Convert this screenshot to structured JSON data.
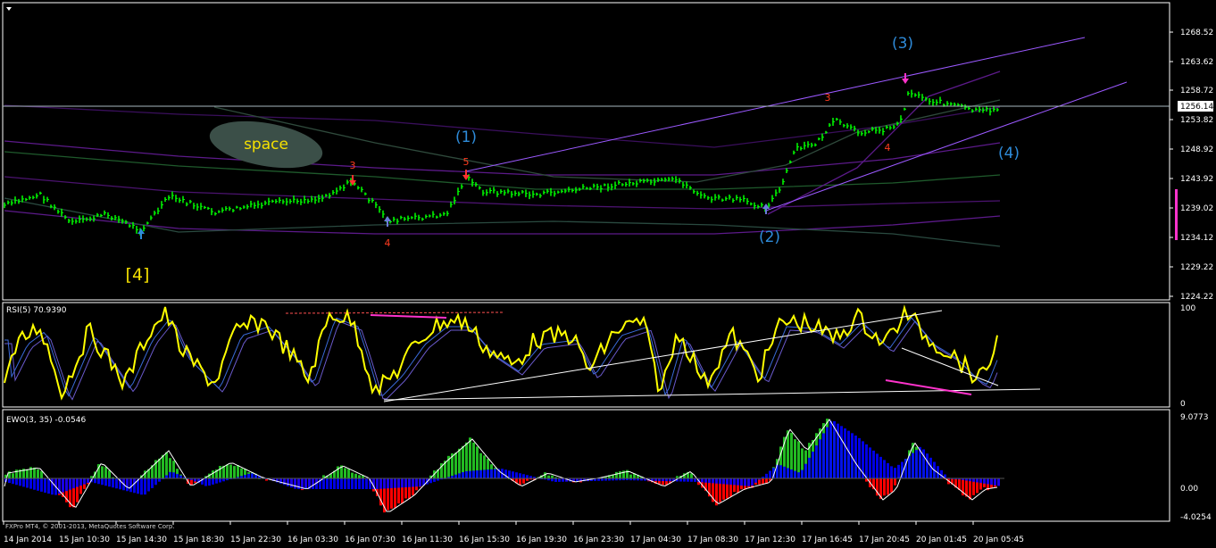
{
  "main_panel": {
    "price_axis": [
      "1268.52",
      "1263.62",
      "1258.72",
      "1253.82",
      "1248.92",
      "1243.92",
      "1239.02",
      "1234.12",
      "1229.22",
      "1224.22"
    ],
    "current_price": "1256.14",
    "waves": {
      "w4_prev": "[4]",
      "w1": "(1)",
      "w2": "(2)",
      "w3": "(3)",
      "w4": "(4)"
    },
    "sub_waves": [
      "3",
      "5",
      "4",
      "3",
      "4"
    ],
    "annotation": "space"
  },
  "rsi_panel": {
    "label": "RSI(5) 70.9390",
    "levels": [
      "100",
      "0"
    ]
  },
  "ewo_panel": {
    "label": "EWO(3, 35) -0.0546",
    "levels": [
      "9.0773",
      "0.00",
      "-4.0254"
    ]
  },
  "footer": {
    "copyright": "FXPro MT4, © 2001-2013, MetaQuotes Software Corp."
  },
  "time_axis": [
    "14 Jan 2014",
    "15 Jan 10:30",
    "15 Jan 14:30",
    "15 Jan 18:30",
    "15 Jan 22:30",
    "16 Jan 03:30",
    "16 Jan 07:30",
    "16 Jan 11:30",
    "16 Jan 15:30",
    "16 Jan 19:30",
    "16 Jan 23:30",
    "17 Jan 04:30",
    "17 Jan 08:30",
    "17 Jan 12:30",
    "17 Jan 16:45",
    "17 Jan 20:45",
    "20 Jan 01:45",
    "20 Jan 05:45"
  ],
  "colors": {
    "price_bars": "#00ff00",
    "rsi_line": "#ffff00",
    "ewo_pos": "#22bb22",
    "ewo_neg": "#ff0000",
    "ewo_blue": "#0000ff",
    "channel": "#9b59ff",
    "wave_label": "#2e8bd9"
  }
}
